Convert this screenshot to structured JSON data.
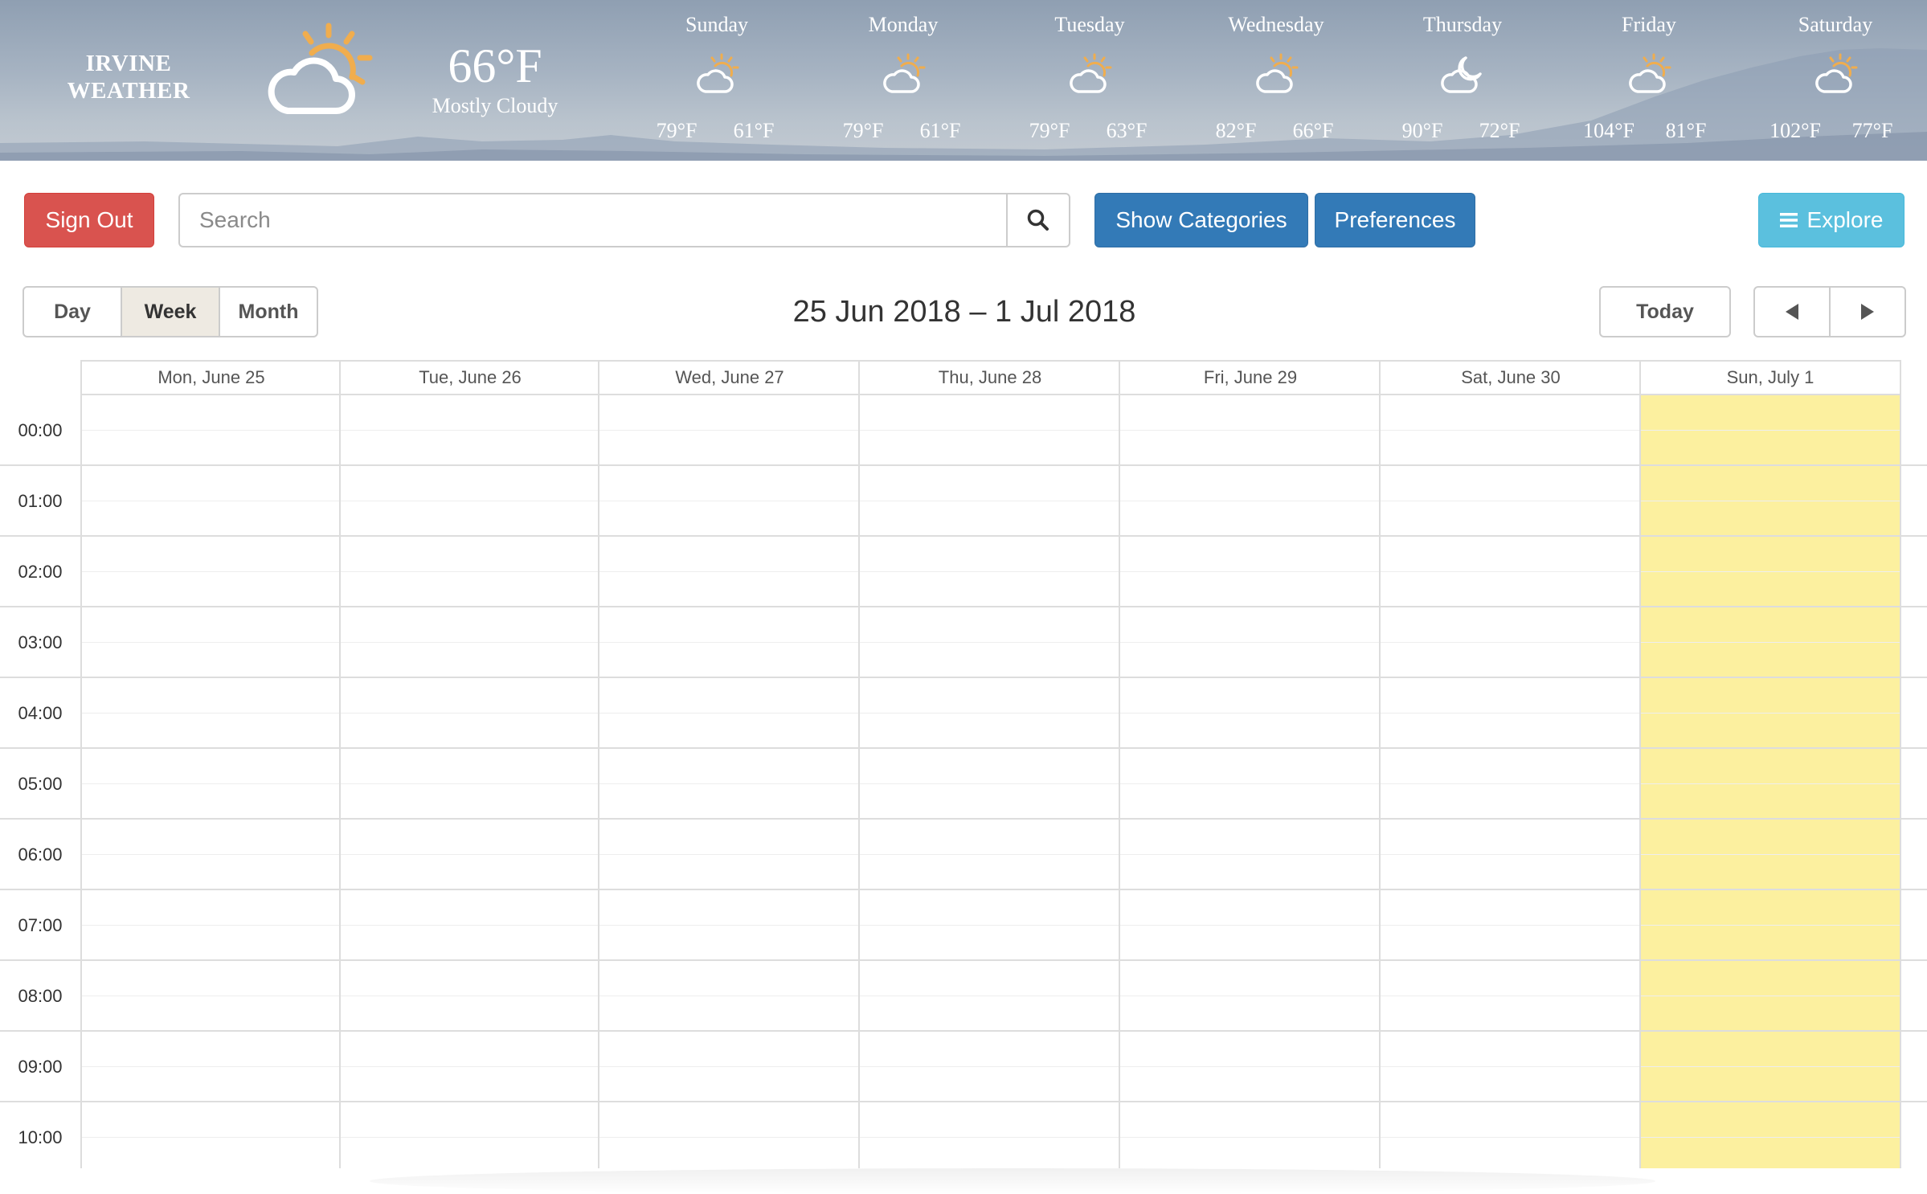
{
  "weather": {
    "city_line1": "IRVINE",
    "city_line2": "WEATHER",
    "current_temp": "66°F",
    "current_condition": "Mostly Cloudy",
    "current_icon": "partly-cloudy-sun-icon",
    "forecast": [
      {
        "day": "Sunday",
        "icon": "partly-cloudy-sun-icon",
        "high": "79°F",
        "low": "61°F"
      },
      {
        "day": "Monday",
        "icon": "partly-cloudy-sun-icon",
        "high": "79°F",
        "low": "61°F"
      },
      {
        "day": "Tuesday",
        "icon": "partly-cloudy-sun-icon",
        "high": "79°F",
        "low": "63°F"
      },
      {
        "day": "Wednesday",
        "icon": "partly-cloudy-sun-icon",
        "high": "82°F",
        "low": "66°F"
      },
      {
        "day": "Thursday",
        "icon": "partly-cloudy-moon-icon",
        "high": "90°F",
        "low": "72°F"
      },
      {
        "day": "Friday",
        "icon": "partly-cloudy-sun-icon",
        "high": "104°F",
        "low": "81°F"
      },
      {
        "day": "Saturday",
        "icon": "partly-cloudy-sun-icon",
        "high": "102°F",
        "low": "77°F"
      }
    ]
  },
  "toolbar": {
    "sign_out_label": "Sign Out",
    "search_placeholder": "Search",
    "search_value": "",
    "show_categories_label": "Show Categories",
    "preferences_label": "Preferences",
    "explore_label": "Explore"
  },
  "calendar": {
    "views": [
      "Day",
      "Week",
      "Month"
    ],
    "active_view": "Week",
    "range_title": "25 Jun 2018 – 1 Jul 2018",
    "today_label": "Today",
    "prev_icon": "triangle-left-icon",
    "next_icon": "triangle-right-icon",
    "columns": [
      "Mon, June 25",
      "Tue, June 26",
      "Wed, June 27",
      "Thu, June 28",
      "Fri, June 29",
      "Sat, June 30",
      "Sun, July 1"
    ],
    "today_column": "Sun, July 1",
    "hours": [
      "00:00",
      "01:00",
      "02:00",
      "03:00",
      "04:00",
      "05:00",
      "06:00",
      "07:00",
      "08:00",
      "09:00",
      "10:00"
    ]
  },
  "colors": {
    "sign_out": "#d9534f",
    "primary": "#337ab7",
    "explore": "#5bc0de",
    "today_highlight": "#fcf09f",
    "sun_orange": "#f0ad4e"
  }
}
